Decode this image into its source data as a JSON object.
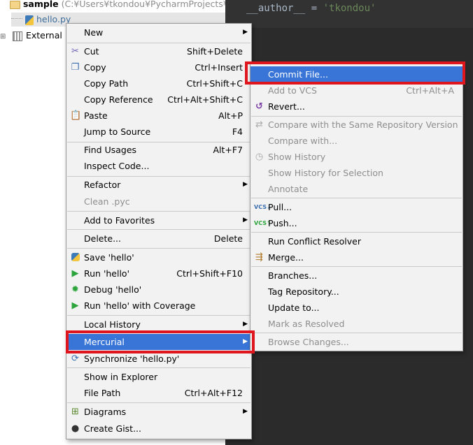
{
  "project_tree": {
    "root_label": "sample",
    "root_path": "(C:¥Users¥tkondou¥PycharmProjects¥sa",
    "file_label": "hello.py",
    "external_label": "External Li"
  },
  "editor": {
    "code_name": "__author__",
    "code_eq": " = ",
    "code_value": "'tkondou'"
  },
  "context_menu": {
    "items": [
      {
        "label": "New",
        "shortcut": ""
      },
      {
        "label": "Cut",
        "shortcut": "Shift+Delete",
        "icon": "scissors-icon"
      },
      {
        "label": "Copy",
        "shortcut": "Ctrl+Insert",
        "icon": "copy-icon"
      },
      {
        "label": "Copy Path",
        "shortcut": "Ctrl+Shift+C"
      },
      {
        "label": "Copy Reference",
        "shortcut": "Ctrl+Alt+Shift+C"
      },
      {
        "label": "Paste",
        "shortcut": "Alt+P",
        "icon": "paste-icon"
      },
      {
        "label": "Jump to Source",
        "shortcut": "F4"
      },
      {
        "label": "Find Usages",
        "shortcut": "Alt+F7"
      },
      {
        "label": "Inspect Code...",
        "shortcut": ""
      },
      {
        "label": "Refactor",
        "shortcut": ""
      },
      {
        "label": "Clean .pyc",
        "shortcut": ""
      },
      {
        "label": "Add to Favorites",
        "shortcut": ""
      },
      {
        "label": "Delete...",
        "shortcut": "Delete"
      },
      {
        "label": "Save 'hello'",
        "shortcut": "",
        "icon": "python-icon"
      },
      {
        "label": "Run 'hello'",
        "shortcut": "Ctrl+Shift+F10",
        "icon": "run-icon"
      },
      {
        "label": "Debug 'hello'",
        "shortcut": "",
        "icon": "debug-icon"
      },
      {
        "label": "Run 'hello' with Coverage",
        "shortcut": "",
        "icon": "coverage-icon"
      },
      {
        "label": "Local History",
        "shortcut": ""
      },
      {
        "label": "Mercurial",
        "shortcut": ""
      },
      {
        "label": "Synchronize 'hello.py'",
        "shortcut": "",
        "icon": "sync-icon"
      },
      {
        "label": "Show in Explorer",
        "shortcut": ""
      },
      {
        "label": "File Path",
        "shortcut": "Ctrl+Alt+F12"
      },
      {
        "label": "Diagrams",
        "shortcut": "",
        "icon": "diagram-icon"
      },
      {
        "label": "Create Gist...",
        "shortcut": "",
        "icon": "github-icon"
      }
    ]
  },
  "submenu": {
    "items": [
      {
        "label": "Commit File...",
        "shortcut": ""
      },
      {
        "label": "Add to VCS",
        "shortcut": "Ctrl+Alt+A"
      },
      {
        "label": "Revert...",
        "shortcut": "",
        "icon": "revert-icon"
      },
      {
        "label": "Compare with the Same Repository Version",
        "shortcut": "",
        "icon": "compare-icon"
      },
      {
        "label": "Compare with...",
        "shortcut": ""
      },
      {
        "label": "Show History",
        "shortcut": "",
        "icon": "history-icon"
      },
      {
        "label": "Show History for Selection",
        "shortcut": ""
      },
      {
        "label": "Annotate",
        "shortcut": ""
      },
      {
        "label": "Pull...",
        "shortcut": "",
        "icon": "vcs-pull-icon"
      },
      {
        "label": "Push...",
        "shortcut": "",
        "icon": "vcs-push-icon"
      },
      {
        "label": "Run Conflict Resolver",
        "shortcut": ""
      },
      {
        "label": "Merge...",
        "shortcut": "",
        "icon": "merge-icon"
      },
      {
        "label": "Branches...",
        "shortcut": ""
      },
      {
        "label": "Tag Repository...",
        "shortcut": ""
      },
      {
        "label": "Update to...",
        "shortcut": ""
      },
      {
        "label": "Mark as Resolved",
        "shortcut": ""
      },
      {
        "label": "Browse Changes...",
        "shortcut": ""
      }
    ]
  },
  "colors": {
    "selection": "#3875d7",
    "highlight_box": "#e0161f",
    "editor_bg": "#2b2b2b",
    "string": "#6a8759"
  }
}
